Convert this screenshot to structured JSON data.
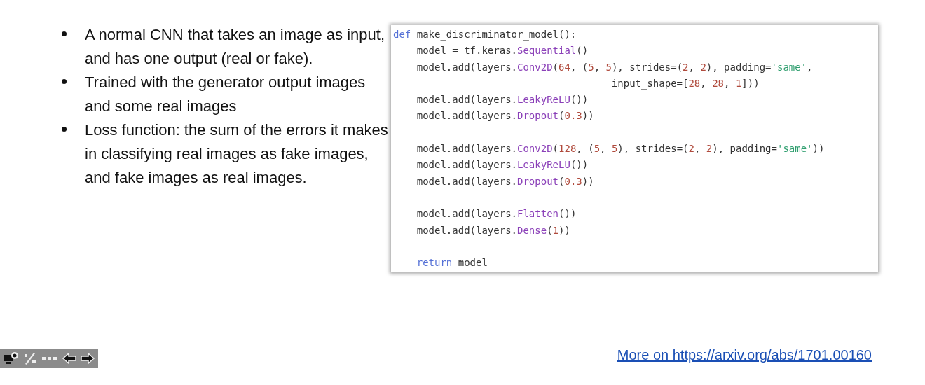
{
  "bullets": [
    "A normal CNN that takes an image as input, and has one output (real or fake).",
    "Trained with the generator output images and some real images",
    "Loss function: the sum of the errors it makes in classifying real images as fake images, and fake images as real images."
  ],
  "code": [
    {
      "kind": "code",
      "tokens": [
        {
          "kind": "keyword",
          "text": "def"
        },
        {
          "kind": "plain",
          "text": " make_discriminator_model():"
        }
      ]
    },
    {
      "kind": "code",
      "tokens": [
        {
          "kind": "plain",
          "text": "    model = tf.keras."
        },
        {
          "kind": "call",
          "text": "Sequential"
        },
        {
          "kind": "plain",
          "text": "()"
        }
      ]
    },
    {
      "kind": "code",
      "tokens": [
        {
          "kind": "plain",
          "text": "    model.add(layers."
        },
        {
          "kind": "call",
          "text": "Conv2D"
        },
        {
          "kind": "plain",
          "text": "("
        },
        {
          "kind": "number",
          "text": "64"
        },
        {
          "kind": "plain",
          "text": ", ("
        },
        {
          "kind": "number",
          "text": "5"
        },
        {
          "kind": "plain",
          "text": ", "
        },
        {
          "kind": "number",
          "text": "5"
        },
        {
          "kind": "plain",
          "text": "), strides=("
        },
        {
          "kind": "number",
          "text": "2"
        },
        {
          "kind": "plain",
          "text": ", "
        },
        {
          "kind": "number",
          "text": "2"
        },
        {
          "kind": "plain",
          "text": "), padding="
        },
        {
          "kind": "string",
          "text": "'same'"
        },
        {
          "kind": "plain",
          "text": ","
        }
      ]
    },
    {
      "kind": "code",
      "tokens": [
        {
          "kind": "plain",
          "text": "                                     input_shape=["
        },
        {
          "kind": "number",
          "text": "28"
        },
        {
          "kind": "plain",
          "text": ", "
        },
        {
          "kind": "number",
          "text": "28"
        },
        {
          "kind": "plain",
          "text": ", "
        },
        {
          "kind": "number",
          "text": "1"
        },
        {
          "kind": "plain",
          "text": "]))"
        }
      ]
    },
    {
      "kind": "code",
      "tokens": [
        {
          "kind": "plain",
          "text": "    model.add(layers."
        },
        {
          "kind": "call",
          "text": "LeakyReLU"
        },
        {
          "kind": "plain",
          "text": "())"
        }
      ]
    },
    {
      "kind": "code",
      "tokens": [
        {
          "kind": "plain",
          "text": "    model.add(layers."
        },
        {
          "kind": "call",
          "text": "Dropout"
        },
        {
          "kind": "plain",
          "text": "("
        },
        {
          "kind": "number",
          "text": "0.3"
        },
        {
          "kind": "plain",
          "text": "))"
        }
      ]
    },
    {
      "kind": "blank"
    },
    {
      "kind": "code",
      "tokens": [
        {
          "kind": "plain",
          "text": "    model.add(layers."
        },
        {
          "kind": "call",
          "text": "Conv2D"
        },
        {
          "kind": "plain",
          "text": "("
        },
        {
          "kind": "number",
          "text": "128"
        },
        {
          "kind": "plain",
          "text": ", ("
        },
        {
          "kind": "number",
          "text": "5"
        },
        {
          "kind": "plain",
          "text": ", "
        },
        {
          "kind": "number",
          "text": "5"
        },
        {
          "kind": "plain",
          "text": "), strides=("
        },
        {
          "kind": "number",
          "text": "2"
        },
        {
          "kind": "plain",
          "text": ", "
        },
        {
          "kind": "number",
          "text": "2"
        },
        {
          "kind": "plain",
          "text": "), padding="
        },
        {
          "kind": "string",
          "text": "'same'"
        },
        {
          "kind": "plain",
          "text": "))"
        }
      ]
    },
    {
      "kind": "code",
      "tokens": [
        {
          "kind": "plain",
          "text": "    model.add(layers."
        },
        {
          "kind": "call",
          "text": "LeakyReLU"
        },
        {
          "kind": "plain",
          "text": "())"
        }
      ]
    },
    {
      "kind": "code",
      "tokens": [
        {
          "kind": "plain",
          "text": "    model.add(layers."
        },
        {
          "kind": "call",
          "text": "Dropout"
        },
        {
          "kind": "plain",
          "text": "("
        },
        {
          "kind": "number",
          "text": "0.3"
        },
        {
          "kind": "plain",
          "text": "))"
        }
      ]
    },
    {
      "kind": "blank"
    },
    {
      "kind": "code",
      "tokens": [
        {
          "kind": "plain",
          "text": "    model.add(layers."
        },
        {
          "kind": "call",
          "text": "Flatten"
        },
        {
          "kind": "plain",
          "text": "())"
        }
      ]
    },
    {
      "kind": "code",
      "tokens": [
        {
          "kind": "plain",
          "text": "    model.add(layers."
        },
        {
          "kind": "call",
          "text": "Dense"
        },
        {
          "kind": "plain",
          "text": "("
        },
        {
          "kind": "number",
          "text": "1"
        },
        {
          "kind": "plain",
          "text": "))"
        }
      ]
    },
    {
      "kind": "blank"
    },
    {
      "kind": "code",
      "tokens": [
        {
          "kind": "keyword",
          "text": "    return"
        },
        {
          "kind": "plain",
          "text": " model"
        }
      ]
    }
  ],
  "link": "More on https://arxiv.org/abs/1701.00160"
}
